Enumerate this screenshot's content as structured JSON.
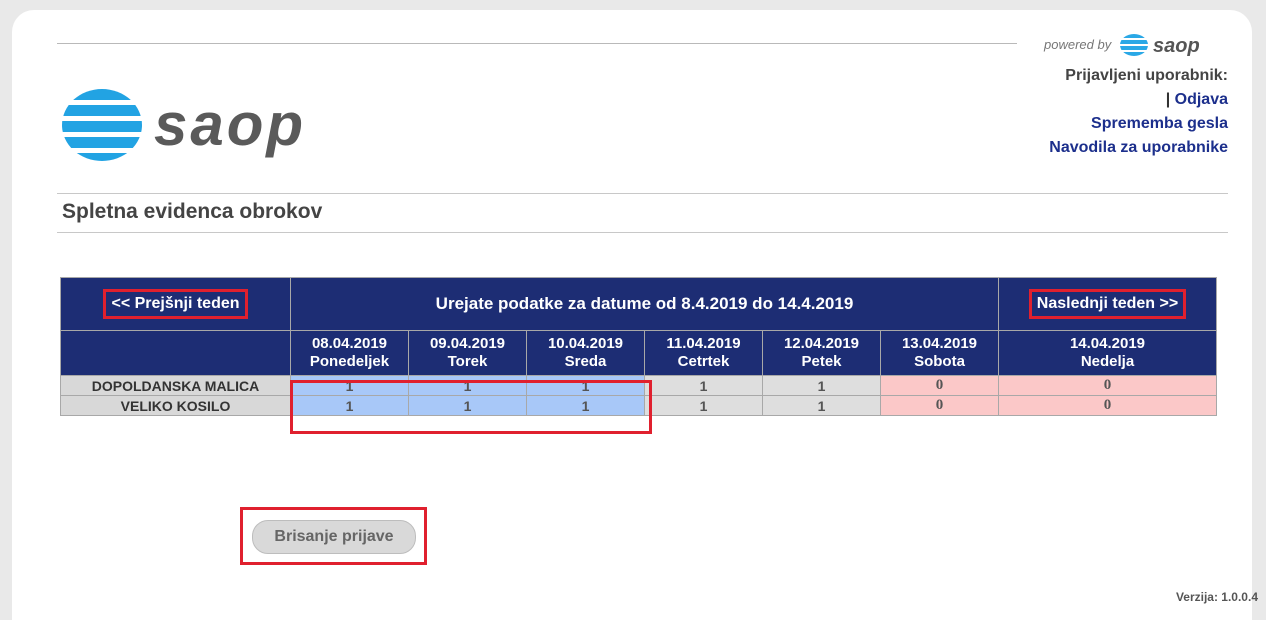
{
  "header": {
    "powered_by": "powered by",
    "powered_logo_text": "saop",
    "logo_text": "saop"
  },
  "user": {
    "logged_in_label": "Prijavljeni uporabnik:",
    "separator": "|",
    "logout": "Odjava",
    "change_password": "Sprememba gesla",
    "user_guide": "Navodila za uporabnike"
  },
  "page": {
    "title": "Spletna evidenca obrokov"
  },
  "week": {
    "prev": "<< Prejšnji teden",
    "range": "Urejate podatke za datume od 8.4.2019 do 14.4.2019",
    "next": "Naslednji teden >>",
    "days": [
      {
        "date": "08.04.2019",
        "name": "Ponedeljek"
      },
      {
        "date": "09.04.2019",
        "name": "Torek"
      },
      {
        "date": "10.04.2019",
        "name": "Sreda"
      },
      {
        "date": "11.04.2019",
        "name": "Cetrtek"
      },
      {
        "date": "12.04.2019",
        "name": "Petek"
      },
      {
        "date": "13.04.2019",
        "name": "Sobota"
      },
      {
        "date": "14.04.2019",
        "name": "Nedelja"
      }
    ]
  },
  "meals": [
    {
      "name": "DOPOLDANSKA MALICA",
      "values": [
        "1",
        "1",
        "1",
        "1",
        "1",
        "0",
        "0"
      ]
    },
    {
      "name": "VELIKO KOSILO",
      "values": [
        "1",
        "1",
        "1",
        "1",
        "1",
        "0",
        "0"
      ]
    }
  ],
  "actions": {
    "delete": "Brisanje prijave"
  },
  "footer": {
    "version": "Verzija: 1.0.0.4"
  },
  "colors": {
    "header_blue": "#1d2d74",
    "link_blue": "#1c2f8c",
    "selected_cell": "#a8c8f8",
    "weekend_cell": "#fbc8c8",
    "weekday_cell": "#dedede",
    "highlight_red": "#e0202e"
  }
}
